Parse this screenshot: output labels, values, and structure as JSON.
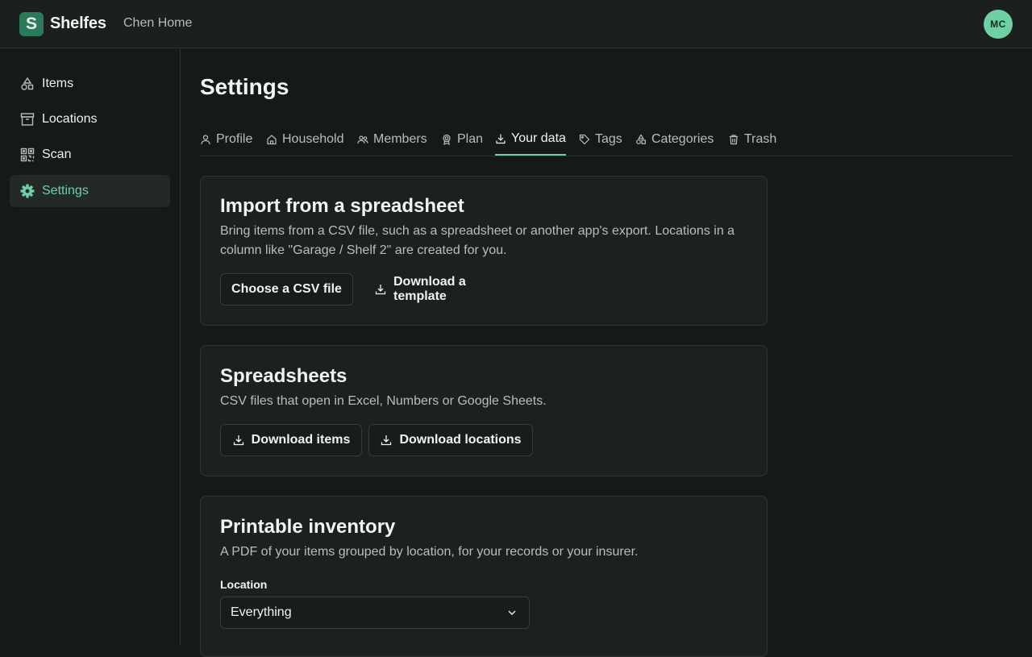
{
  "header": {
    "logo_letter": "S",
    "app_name": "Shelfes",
    "household_name": "Chen Home",
    "avatar_initials": "MC"
  },
  "sidebar": {
    "items": [
      {
        "label": "Items",
        "icon": "shapes-icon",
        "active": false
      },
      {
        "label": "Locations",
        "icon": "archive-box-icon",
        "active": false
      },
      {
        "label": "Scan",
        "icon": "qr-code-icon",
        "active": false
      },
      {
        "label": "Settings",
        "icon": "gear-icon",
        "active": true
      }
    ]
  },
  "page": {
    "title": "Settings"
  },
  "tabs": [
    {
      "label": "Profile",
      "icon": "user-icon"
    },
    {
      "label": "Household",
      "icon": "home-icon"
    },
    {
      "label": "Members",
      "icon": "users-icon"
    },
    {
      "label": "Plan",
      "icon": "badge-icon"
    },
    {
      "label": "Your data",
      "icon": "download-icon",
      "active": true
    },
    {
      "label": "Tags",
      "icon": "tag-icon"
    },
    {
      "label": "Categories",
      "icon": "shapes-icon"
    },
    {
      "label": "Trash",
      "icon": "trash-icon"
    }
  ],
  "import_card": {
    "title": "Import from a spreadsheet",
    "description": "Bring items from a CSV file, such as a spreadsheet or another app's export. Locations in a column like \"Garage / Shelf 2\" are created for you.",
    "choose_button": "Choose a CSV file",
    "template_button": "Download a template"
  },
  "spreadsheets_card": {
    "title": "Spreadsheets",
    "description": "CSV files that open in Excel, Numbers or Google Sheets.",
    "items_button": "Download items",
    "locations_button": "Download locations"
  },
  "printable_card": {
    "title": "Printable inventory",
    "description": "A PDF of your items grouped by location, for your records or your insurer.",
    "location_label": "Location",
    "location_value": "Everything"
  },
  "colors": {
    "accent": "#6fcfa5",
    "brand": "#2b7a59",
    "background": "#151918",
    "card": "#1c2120"
  }
}
